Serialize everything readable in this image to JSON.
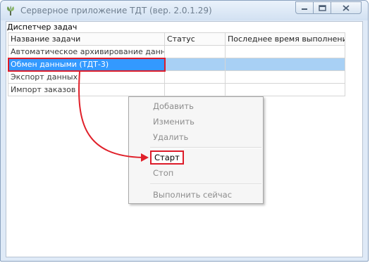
{
  "window": {
    "title": "Серверное приложение ТДТ (вер. 2.0.1.29)",
    "controls": {
      "minimize": "minimize-icon",
      "maximize": "maximize-icon",
      "close": "close-icon"
    }
  },
  "dispatcher": {
    "label": "Диспетчер задач"
  },
  "table": {
    "columns": [
      "Название задачи",
      "Статус",
      "Последнее время выполнения"
    ],
    "rows": [
      {
        "name": "Автоматическое архивирование данных",
        "status": "",
        "last_run": ""
      },
      {
        "name": "Обмен данными (ТДТ-3)",
        "status": "",
        "last_run": ""
      },
      {
        "name": "Экспорт данных",
        "status": "",
        "last_run": ""
      },
      {
        "name": "Импорт заказов",
        "status": "",
        "last_run": ""
      }
    ],
    "selected_row": 1
  },
  "context_menu": {
    "items": [
      "Добавить",
      "Изменить",
      "Удалить",
      "Старт",
      "Стоп",
      "Выполнить сейчас"
    ],
    "enabled": [
      "Старт"
    ]
  },
  "colors": {
    "selection": "#3399ff",
    "selection_light": "#a8d0f5",
    "highlight": "#dd1c2a"
  }
}
